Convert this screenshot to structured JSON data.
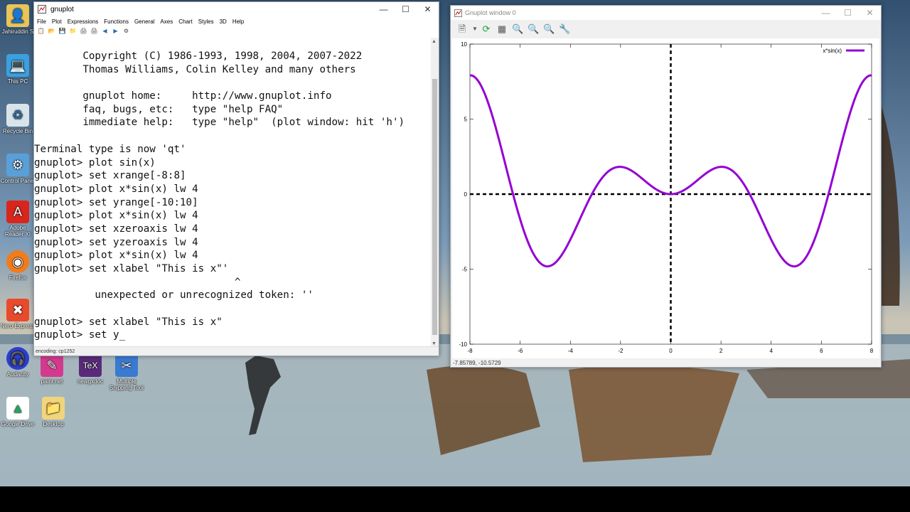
{
  "desktop": {
    "icons": [
      {
        "label": "Jahiruddin S"
      },
      {
        "label": "This PC"
      },
      {
        "label": "Recycle Bin"
      },
      {
        "label": "Control Panel"
      },
      {
        "label": "Adobe Reader XI"
      },
      {
        "label": "Firefox"
      },
      {
        "label": "Nero Express"
      },
      {
        "label": "Audacity"
      },
      {
        "label": "paint.net"
      },
      {
        "label": "newgxdoc"
      },
      {
        "label": "Multiple Snipping Tool"
      },
      {
        "label": "Google Drive"
      },
      {
        "label": "Desktop"
      }
    ]
  },
  "console_window": {
    "title": "gnuplot",
    "menu": [
      "File",
      "Plot",
      "Expressions",
      "Functions",
      "General",
      "Axes",
      "Chart",
      "Styles",
      "3D",
      "Help"
    ],
    "lines": [
      "        Copyright (C) 1986-1993, 1998, 2004, 2007-2022",
      "        Thomas Williams, Colin Kelley and many others",
      "",
      "        gnuplot home:     http://www.gnuplot.info",
      "        faq, bugs, etc:   type \"help FAQ\"",
      "        immediate help:   type \"help\"  (plot window: hit 'h')",
      "",
      "Terminal type is now 'qt'",
      "gnuplot> plot sin(x)",
      "gnuplot> set xrange[-8:8]",
      "gnuplot> plot x*sin(x) lw 4",
      "gnuplot> set yrange[-10:10]",
      "gnuplot> plot x*sin(x) lw 4",
      "gnuplot> set xzeroaxis lw 4",
      "gnuplot> set yzeroaxis lw 4",
      "gnuplot> plot x*sin(x) lw 4",
      "gnuplot> set xlabel \"This is x\"'",
      "                                 ^",
      "          unexpected or unrecognized token: ''",
      "",
      "gnuplot> set xlabel \"This is x\"",
      "gnuplot> set y_"
    ],
    "status": "encoding: cp1252"
  },
  "plot_window": {
    "title": "Gnuplot window 0",
    "status": "-7.85789, -10.5729"
  },
  "chart_data": {
    "type": "line",
    "function": "x*sin(x)",
    "xlim": [
      -8,
      8
    ],
    "ylim": [
      -10,
      10
    ],
    "xticks": [
      "-8",
      "-6",
      "-4",
      "-2",
      "0",
      "2",
      "4",
      "6",
      "8"
    ],
    "yticks": [
      "-10",
      "-5",
      "0",
      "5",
      "10"
    ],
    "series": [
      {
        "name": "x*sin(x)",
        "color": "#9400d3"
      }
    ],
    "legend": "top-right",
    "zero_axes": true
  }
}
